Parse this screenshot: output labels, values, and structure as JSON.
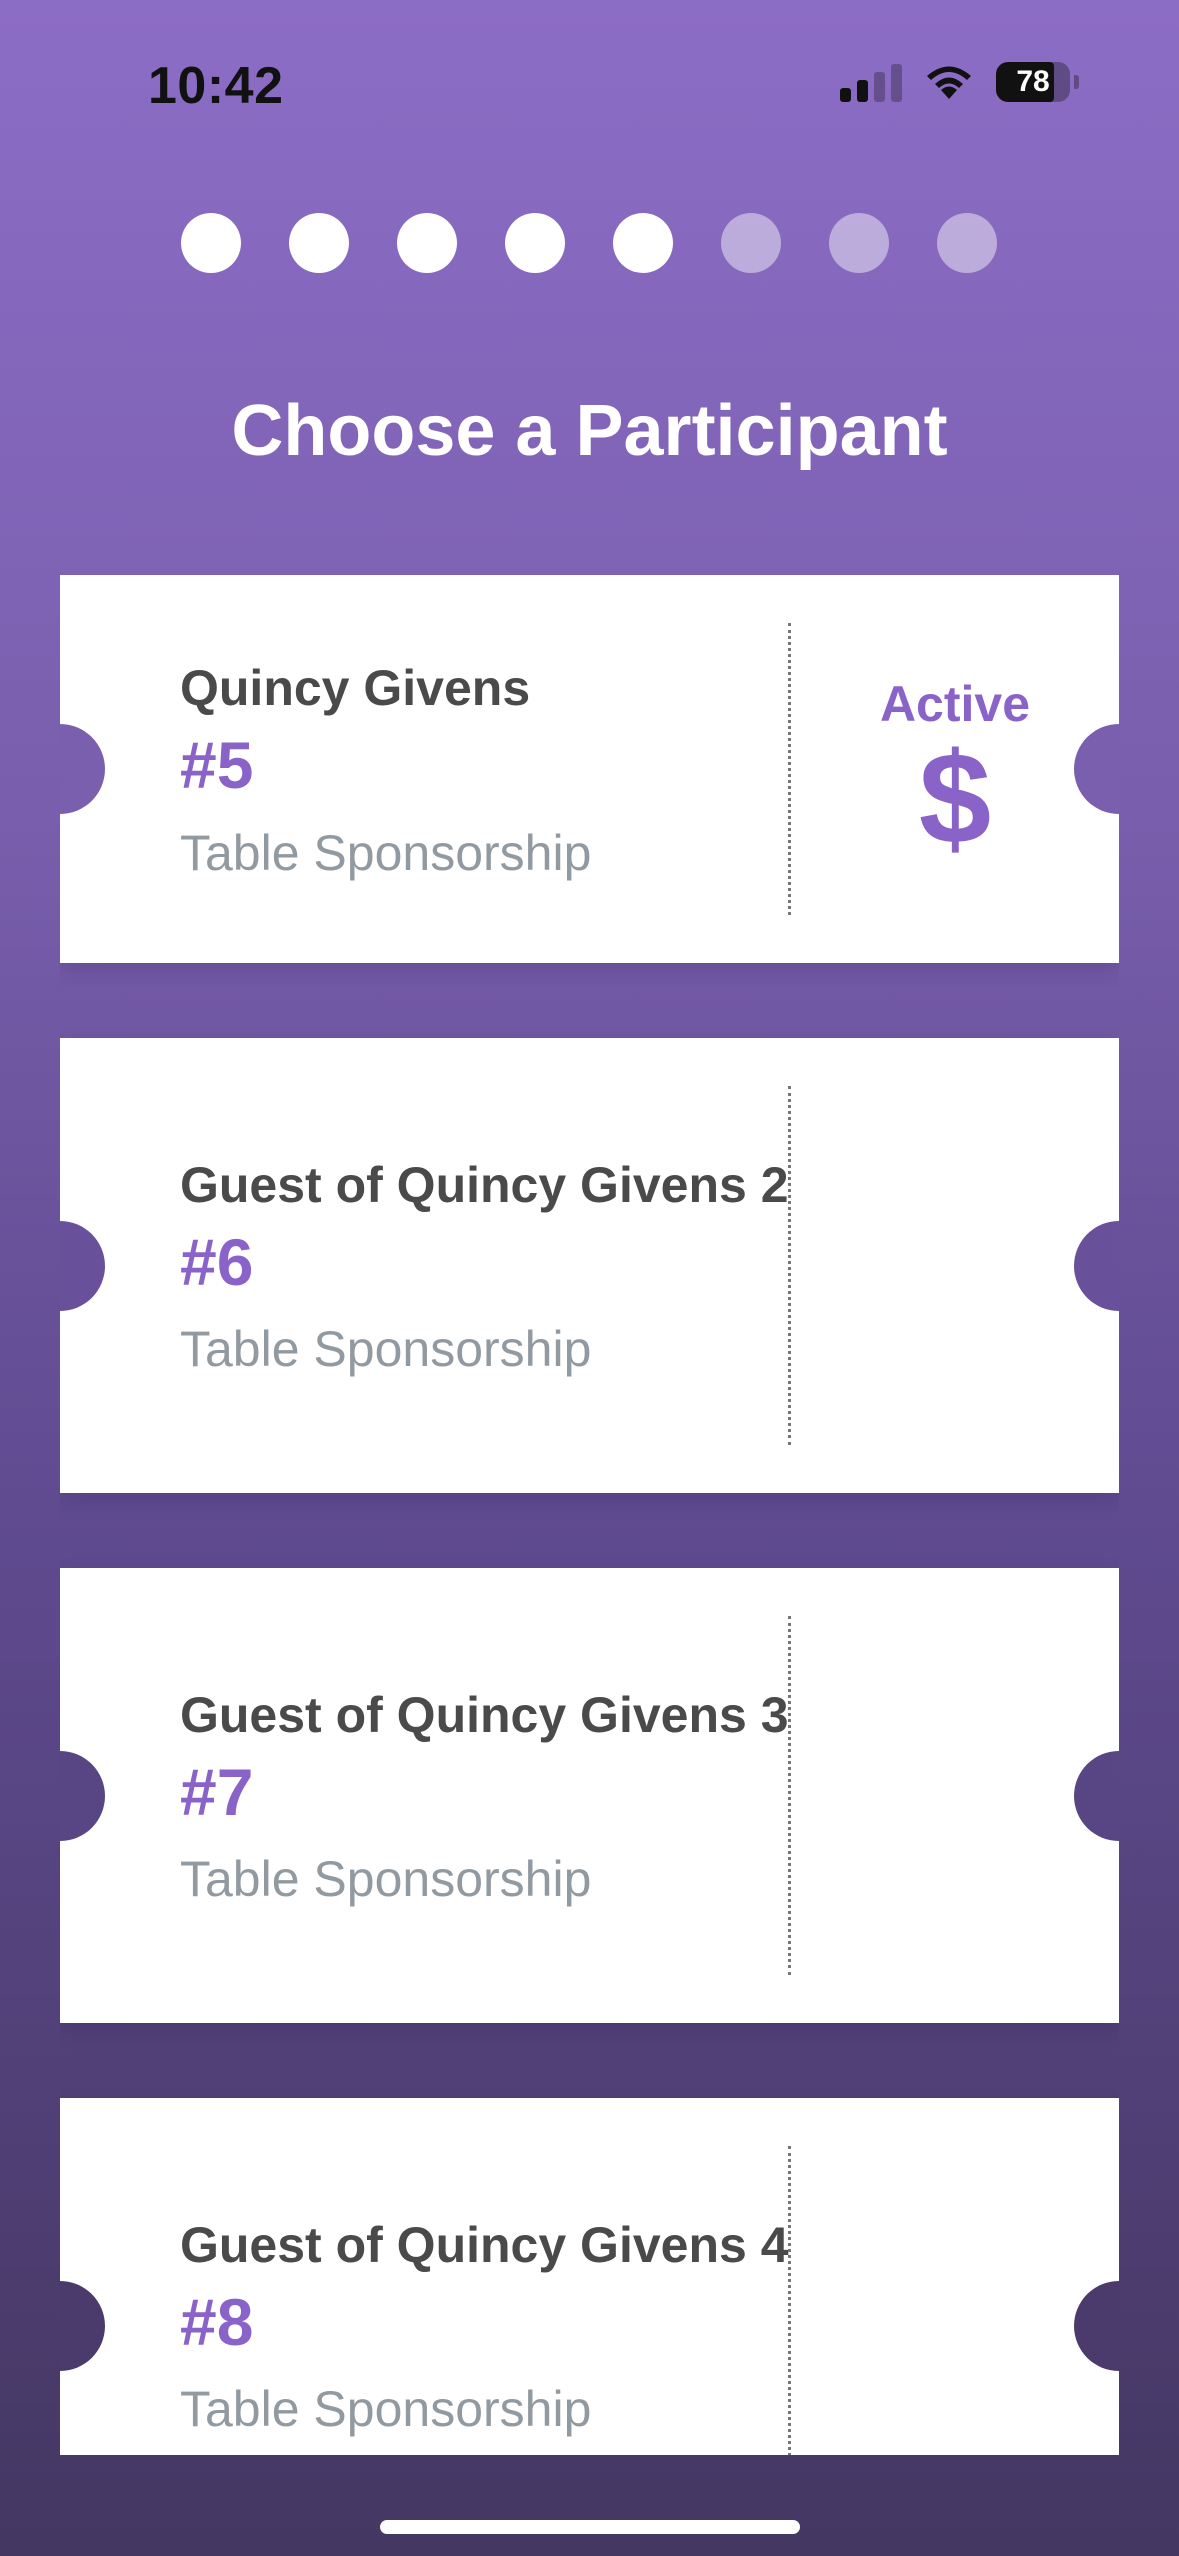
{
  "status_bar": {
    "time": "10:42",
    "battery": "78",
    "battery_level": 0.78,
    "icons": [
      "cellular-signal-icon",
      "wifi-icon",
      "battery-icon"
    ]
  },
  "progress": {
    "total_steps": 8,
    "completed_steps": 5
  },
  "header": {
    "title": "Choose a Participant"
  },
  "colors": {
    "accent": "#8a63c9",
    "name_text": "#4a4a4a",
    "type_text": "#929aa1"
  },
  "participants": [
    {
      "name": "Quincy Givens",
      "number": "#5",
      "type": "Table Sponsorship",
      "status": "Active",
      "icon": "dollar-icon"
    },
    {
      "name": "Guest of Quincy Givens 2",
      "number": "#6",
      "type": "Table Sponsorship"
    },
    {
      "name": "Guest of Quincy Givens 3",
      "number": "#7",
      "type": "Table Sponsorship"
    },
    {
      "name": "Guest of Quincy Givens 4",
      "number": "#8",
      "type": "Table Sponsorship"
    }
  ]
}
